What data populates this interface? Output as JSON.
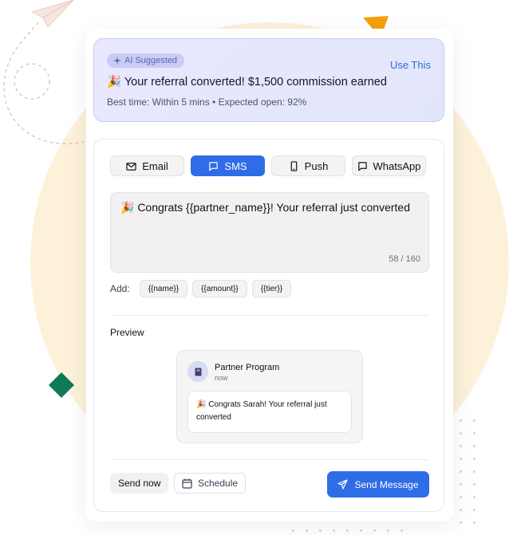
{
  "ai_banner": {
    "badge": "AI Suggested",
    "action": "Use This",
    "message": "🎉 Your referral converted! $1,500 commission earned",
    "meta": "Best time: Within 5 mins • Expected open: 92%"
  },
  "channels": [
    {
      "label": "Email",
      "icon": "mail-icon",
      "active": false
    },
    {
      "label": "SMS",
      "icon": "message-icon",
      "active": true
    },
    {
      "label": "Push",
      "icon": "phone-icon",
      "active": false
    },
    {
      "label": "WhatsApp",
      "icon": "chat-icon",
      "active": false
    }
  ],
  "composer": {
    "text": "🎉 Congrats {{partner_name}}! Your referral just converted",
    "counter": "58 / 160"
  },
  "variables": {
    "label": "Add:",
    "chips": [
      "{{name}}",
      "{{amount}}",
      "{{tier}}"
    ]
  },
  "preview": {
    "label": "Preview",
    "sender": "Partner Program",
    "time": "now",
    "message": "🎉 Congrats Sarah! Your referral just converted"
  },
  "footer": {
    "send_now": "Send now",
    "schedule": "Schedule",
    "send_message": "Send Message"
  },
  "colors": {
    "accent": "#2f6ce8",
    "background_circle": "#fdf1da",
    "ai_gradient": "#e9e8ff",
    "triangle": "#f5a00a",
    "diamond": "#0f7a5a"
  }
}
